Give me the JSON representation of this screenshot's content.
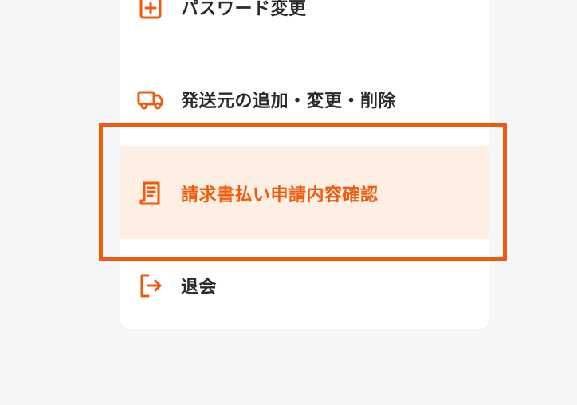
{
  "menu": {
    "items": [
      {
        "label": "パスワード変更",
        "icon": "password-change-icon",
        "active": false
      },
      {
        "label": "発送元の追加・変更・削除",
        "icon": "truck-icon",
        "active": false
      },
      {
        "label": "請求書払い申請内容確認",
        "icon": "receipt-icon",
        "active": true
      },
      {
        "label": "退会",
        "icon": "logout-icon",
        "active": false
      }
    ]
  },
  "colors": {
    "accent": "#f05a0a",
    "active_bg": "#feefe4",
    "text": "#2b2b2b",
    "page_bg": "#f5f6f8"
  }
}
